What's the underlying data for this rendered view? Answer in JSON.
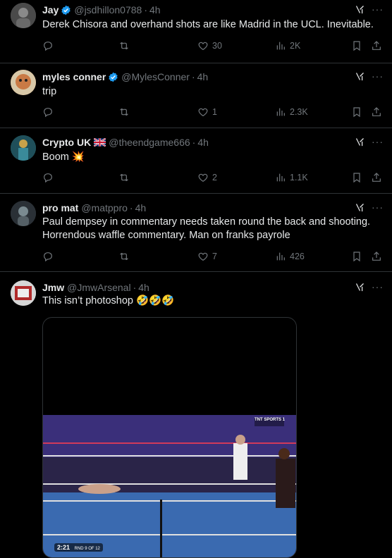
{
  "tweets": [
    {
      "name": "Jay",
      "handle": "@jsdhillon0788",
      "time": "4h",
      "verified": true,
      "text": "Derek Chisora and overhand shots are like Madrid in the UCL. Inevitable.",
      "likes": "30",
      "views": "2K",
      "avatar_color": "#5a5a5a"
    },
    {
      "name": "myles conner",
      "handle": "@MylesConner",
      "time": "4h",
      "verified": true,
      "text": "trip",
      "likes": "1",
      "views": "2.3K",
      "avatar_color": "#c97a45"
    },
    {
      "name": "Crypto UK",
      "handle": "@theendgame666",
      "time": "4h",
      "verified": false,
      "flag": "uk-flag",
      "text": "Boom",
      "emoji": "💥",
      "likes": "2",
      "views": "1.1K",
      "avatar_color": "#2a6f6a"
    },
    {
      "name": "pro mat",
      "handle": "@matppro",
      "time": "4h",
      "verified": false,
      "text": "Paul dempsey in commentary needs taken round the back and shooting. Horrendous waffle commentary. Man on franks payrole",
      "likes": "7",
      "views": "426",
      "avatar_color": "#3a4046"
    },
    {
      "name": "Jmw",
      "handle": "@JmwArsenal",
      "time": "4h",
      "verified": false,
      "text": "This isn’t photoshop",
      "emoji": "🤣🤣🤣",
      "avatar_color": "#c8c8c8",
      "video_time": "2:21",
      "video_round": "RND 9 OF 12",
      "video_channel": "TNT SPORTS 1"
    }
  ],
  "colors": {
    "background": "#000000",
    "text": "#e7e9ea",
    "muted": "#71767b",
    "divider": "#2f3336",
    "verified": "#1d9bf0"
  },
  "icons": {
    "reply": "reply-icon",
    "retweet": "retweet-icon",
    "like": "heart-icon",
    "views": "views-icon",
    "bookmark": "bookmark-icon",
    "share": "share-icon",
    "grok": "grok-icon",
    "more": "more-icon"
  }
}
